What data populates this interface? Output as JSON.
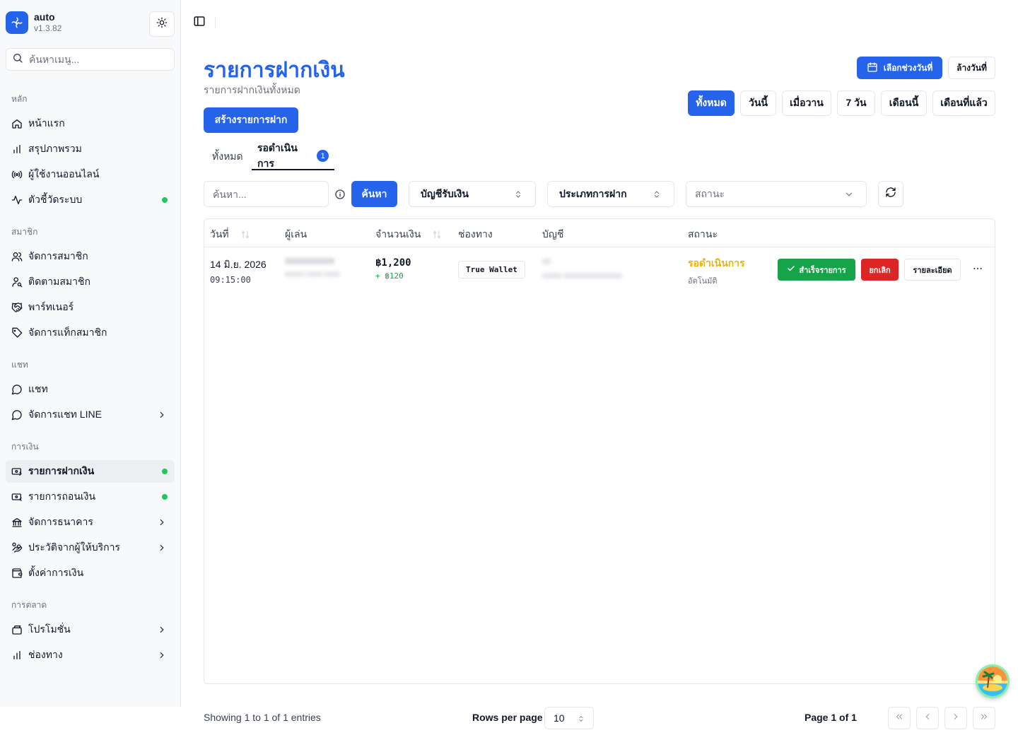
{
  "app": {
    "name": "auto",
    "version": "v1.3.82"
  },
  "sidebar": {
    "search_placeholder": "ค้นหาเมนู...",
    "groups": [
      {
        "label": "หลัก",
        "items": [
          {
            "label": "หน้าแรก",
            "icon": "home-icon"
          },
          {
            "label": "สรุปภาพรวม",
            "icon": "bar-chart-icon"
          },
          {
            "label": "ผู้ใช้งานออนไลน์",
            "icon": "radio-icon"
          },
          {
            "label": "ตัวชี้วัดระบบ",
            "icon": "activity-icon",
            "dot": true
          }
        ]
      },
      {
        "label": "สมาชิก",
        "items": [
          {
            "label": "จัดการสมาชิก",
            "icon": "users-icon"
          },
          {
            "label": "ติดตามสมาชิก",
            "icon": "user-search-icon"
          },
          {
            "label": "พาร์ทเนอร์",
            "icon": "handshake-icon"
          },
          {
            "label": "จัดการแท็กสมาชิก",
            "icon": "tag-icon"
          }
        ]
      },
      {
        "label": "แชท",
        "items": [
          {
            "label": "แชท",
            "icon": "message-circle-icon"
          },
          {
            "label": "จัดการแชท LINE",
            "icon": "message-circle-icon",
            "chevron": true
          }
        ]
      },
      {
        "label": "การเงิน",
        "items": [
          {
            "label": "รายการฝากเงิน",
            "icon": "money-in-icon",
            "dot": true,
            "active": true
          },
          {
            "label": "รายการถอนเงิน",
            "icon": "money-out-icon",
            "dot": true
          },
          {
            "label": "จัดการธนาคาร",
            "icon": "bank-icon",
            "chevron": true
          },
          {
            "label": "ประวัติจากผู้ให้บริการ",
            "icon": "hand-coins-icon",
            "chevron": true
          },
          {
            "label": "ตั้งค่าการเงิน",
            "icon": "wallet-icon"
          }
        ]
      },
      {
        "label": "การตลาด",
        "items": [
          {
            "label": "โปรโมชั่น",
            "icon": "wallet-icon",
            "chevron": true
          },
          {
            "label": "ช่องทาง",
            "icon": "bar-chart-icon",
            "chevron": true
          }
        ]
      }
    ]
  },
  "header": {
    "title": "รายการฝากเงิน",
    "subtitle": "รายการฝากเงินทั้งหมด",
    "create_label": "สร้างรายการฝาก",
    "date_range_label": "เลือกช่วงวันที่",
    "clear_date_label": "ล้างวันที่",
    "quick_filters": [
      "ทั้งหมด",
      "วันนี้",
      "เมื่อวาน",
      "7 วัน",
      "เดือนนี้",
      "เดือนที่แล้ว"
    ],
    "active_quick_filter": "ทั้งหมด"
  },
  "tabs": [
    {
      "label": "ทั้งหมด"
    },
    {
      "label": "รอดำเนินการ",
      "badge": "1",
      "active": true
    }
  ],
  "filters": {
    "search_placeholder": "ค้นหา...",
    "search_button": "ค้นหา",
    "account_select": "บัญชีรับเงิน",
    "type_select": "ประเภทการฝาก",
    "status_placeholder": "สถานะ"
  },
  "table": {
    "columns": [
      "วันที่",
      "ผู้เล่น",
      "จำนวนเงิน",
      "ช่องทาง",
      "บัญชี",
      "สถานะ"
    ],
    "rows": [
      {
        "date": "14 มิ.ย. 2026",
        "time": "09:15:00",
        "player": "xxxxxxxxx",
        "player_sub": "xxxxx xxxx xxxx",
        "amount": "฿1,200",
        "bonus": "+ ฿120",
        "channel": "True Wallet",
        "account": "xx",
        "account_sub": "xxxxx xxxxxxxxxxxxxxx",
        "status": "รอดำเนินการ",
        "status_sub": "อัตโนมัติ",
        "approve_label": "สำเร็จรายการ",
        "cancel_label": "ยกเลิก",
        "detail_label": "รายละเอียด"
      }
    ]
  },
  "footer": {
    "showing": "Showing 1 to 1 of 1 entries",
    "rows_per_page_label": "Rows per page",
    "rows_per_page": "10",
    "page_label": "Page 1 of 1"
  },
  "colors": {
    "accent": "#2563eb",
    "success": "#16a34a",
    "danger": "#dc2626",
    "warning": "#eab308",
    "dot": "#22c55e"
  }
}
